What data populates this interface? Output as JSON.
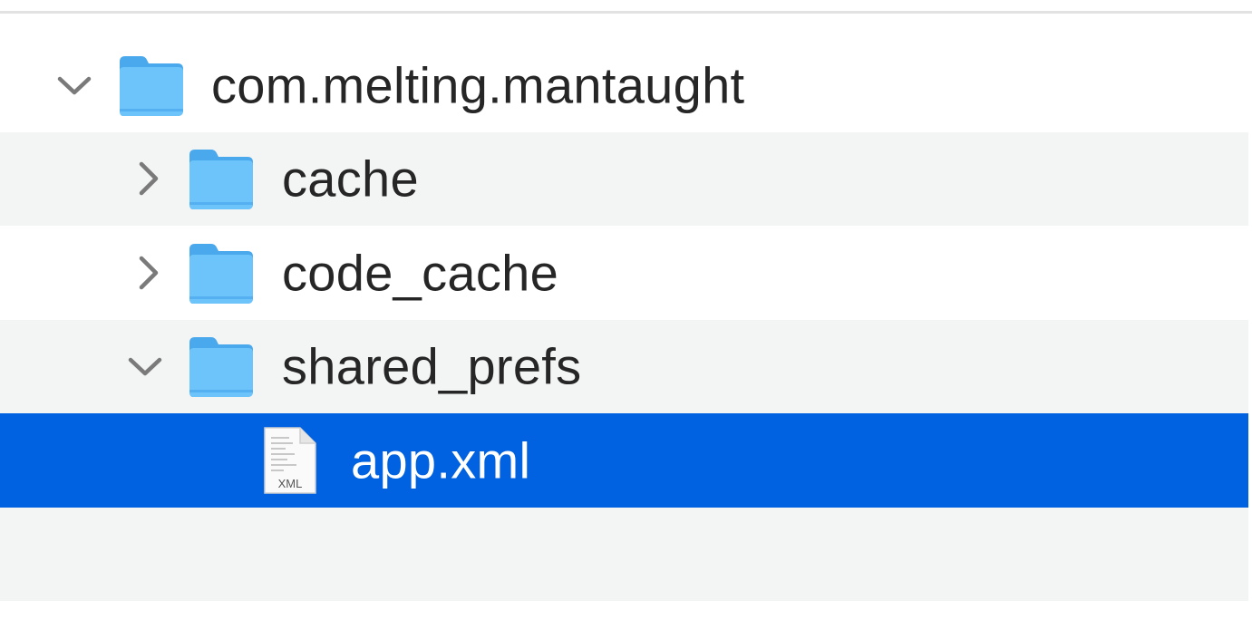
{
  "tree": {
    "items": [
      {
        "label": "com.melting.mantaught",
        "type": "folder",
        "expanded": true,
        "icon": "folder-icon",
        "chevron": "chevron-down-icon"
      },
      {
        "label": "cache",
        "type": "folder",
        "expanded": false,
        "icon": "folder-icon",
        "chevron": "chevron-right-icon"
      },
      {
        "label": "code_cache",
        "type": "folder",
        "expanded": false,
        "icon": "folder-icon",
        "chevron": "chevron-right-icon"
      },
      {
        "label": "shared_prefs",
        "type": "folder",
        "expanded": true,
        "icon": "folder-icon",
        "chevron": "chevron-down-icon"
      },
      {
        "label": "app.xml",
        "type": "file",
        "selected": true,
        "icon": "xml-file-icon",
        "badge": "XML"
      }
    ]
  },
  "colors": {
    "selection": "#0062e0",
    "alt_row": "#f3f4f4",
    "folder_blue": "#5cb8f5",
    "text": "#262626"
  }
}
